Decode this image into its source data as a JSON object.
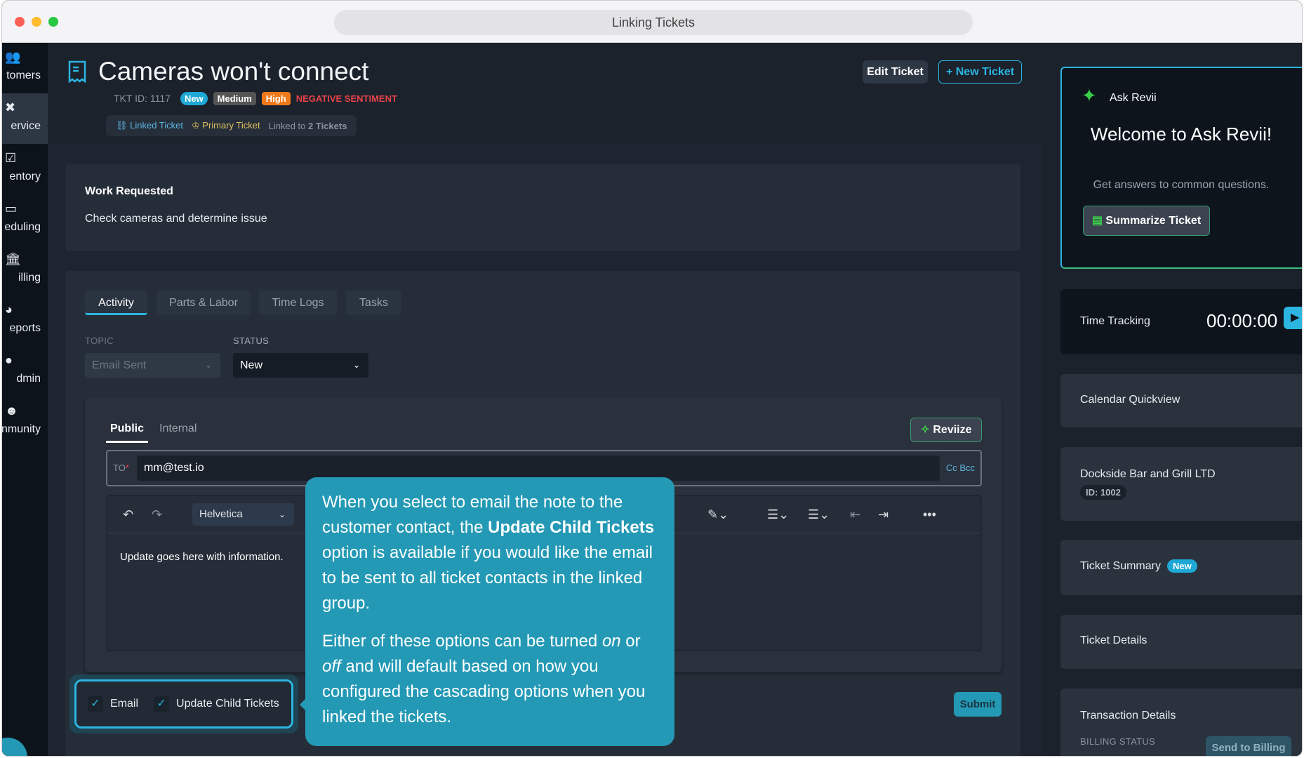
{
  "window": {
    "title": "Linking Tickets"
  },
  "sidebar": {
    "items": [
      {
        "label": "tomers",
        "icon": "people-icon"
      },
      {
        "label": "ervice",
        "icon": "tools-icon"
      },
      {
        "label": "entory",
        "icon": "clipboard-check-icon"
      },
      {
        "label": "eduling",
        "icon": "calendar-icon"
      },
      {
        "label": "illing",
        "icon": "bank-icon"
      },
      {
        "label": "eports",
        "icon": "pie-chart-icon"
      },
      {
        "label": "dmin",
        "icon": "admin-icon"
      },
      {
        "label": "nmunity",
        "icon": "community-icon"
      }
    ]
  },
  "ticket": {
    "title": "Cameras won't connect",
    "id_label": "TKT ID: 1117",
    "status_badge": "New",
    "priority_badge": "Medium",
    "urgency_badge": "High",
    "sentiment": "NEGATIVE SENTIMENT",
    "linked_label": "Linked Ticket",
    "primary_label": "Primary Ticket",
    "linked_to_prefix": "Linked to",
    "linked_to_count": "2 Tickets",
    "edit_button": "Edit Ticket",
    "new_button": "New Ticket"
  },
  "work": {
    "heading": "Work Requested",
    "text": "Check cameras and determine issue"
  },
  "tabs": [
    "Activity",
    "Parts & Labor",
    "Time Logs",
    "Tasks"
  ],
  "form": {
    "topic_label": "TOPIC",
    "topic_value": "Email Sent",
    "status_label": "STATUS",
    "status_value": "New"
  },
  "compose": {
    "tabs": [
      "Public",
      "Internal"
    ],
    "reviize": "Reviize",
    "to_label": "TO",
    "to_value": "mm@test.io",
    "cc_bcc": "Cc Bcc",
    "font": "Helvetica",
    "body": "Update goes here with information.",
    "email_label": "Email",
    "child_label": "Update Child Tickets",
    "submit": "Submit"
  },
  "tooltip": {
    "p1_a": "When you select to email the note to the customer contact, the ",
    "p1_b": "Update Child Tickets",
    "p1_c": " option is available if you would like the email to be sent to all ticket contacts in the linked group.",
    "p2_a": "Either of these options can be turned ",
    "p2_b": "on",
    "p2_c": " or ",
    "p2_d": "off",
    "p2_e": " and will default based on how you configured the cascading options when you linked the tickets."
  },
  "right": {
    "ask_title": "Ask Revii",
    "welcome": "Welcome to Ask Revii!",
    "sub": "Get answers to common questions.",
    "summarize": "Summarize Ticket",
    "time_label": "Time Tracking",
    "time_value": "00:00:00",
    "calendar": "Calendar Quickview",
    "customer": "Dockside Bar and Grill LTD",
    "customer_id": "ID: 1002",
    "summary": "Ticket Summary",
    "summary_badge": "New",
    "details": "Ticket Details",
    "transaction": "Transaction Details",
    "billing_status": "BILLING STATUS",
    "send_billing": "Send to Billing"
  },
  "colors": {
    "accent": "#2bb5e0",
    "tooltip": "#2499b5",
    "high": "#f07a1a",
    "negative": "#e8424a",
    "green": "#3ad14a"
  }
}
